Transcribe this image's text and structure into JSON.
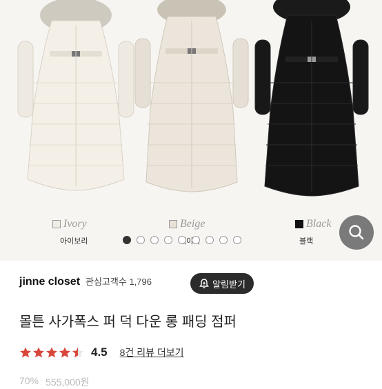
{
  "gallery": {
    "swatches": [
      {
        "name_en": "Ivory",
        "name_ko": "아이보리",
        "color": "#f2ede4"
      },
      {
        "name_en": "Beige",
        "name_ko": "베이지",
        "color": "#e8e1d6"
      },
      {
        "name_en": "Black",
        "name_ko": "블랙",
        "color": "#111111"
      }
    ],
    "dots": [
      "active",
      "",
      "",
      "",
      "",
      "",
      "",
      "",
      ""
    ]
  },
  "seller": {
    "name": "jinne closet",
    "followers": "관심고객수 1,796",
    "follow_label": "알림받기"
  },
  "product": {
    "title": "몰튼 사가폭스 퍼 덕 다운 롱 패딩 점퍼"
  },
  "rating": {
    "value": "4.5",
    "stars": 4.5,
    "reviews_label": "8건 리뷰 더보기",
    "star_color": "#d9473b"
  },
  "price": {
    "discount": "70%",
    "original": "555,000원"
  }
}
